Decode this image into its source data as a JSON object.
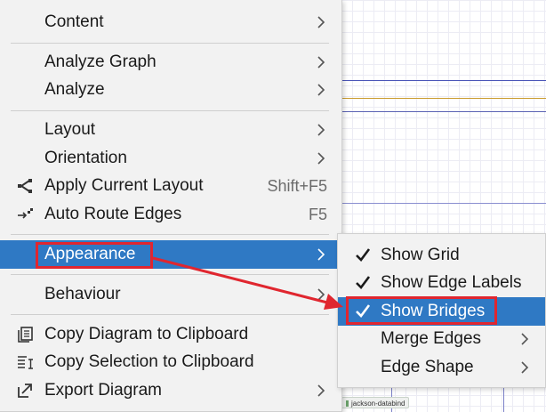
{
  "canvas": {
    "node_label": "jackson-databind"
  },
  "main_menu": {
    "items": [
      {
        "label": "Content",
        "submenu": true
      },
      {
        "label": "Analyze Graph",
        "submenu": true
      },
      {
        "label": "Analyze",
        "submenu": true
      },
      {
        "label": "Layout",
        "submenu": true
      },
      {
        "label": "Orientation",
        "submenu": true
      },
      {
        "label": "Apply Current Layout",
        "shortcut": "Shift+F5",
        "icon": "apply-layout-icon"
      },
      {
        "label": "Auto Route Edges",
        "shortcut": "F5",
        "icon": "auto-route-icon"
      },
      {
        "label": "Appearance",
        "submenu": true,
        "active": true
      },
      {
        "label": "Behaviour",
        "submenu": true
      },
      {
        "label": "Copy Diagram to Clipboard",
        "icon": "copy-diagram-icon"
      },
      {
        "label": "Copy Selection to Clipboard",
        "icon": "copy-selection-icon"
      },
      {
        "label": "Export Diagram",
        "submenu": true,
        "icon": "export-icon"
      }
    ]
  },
  "appearance_submenu": {
    "items": [
      {
        "label": "Show Grid",
        "checked": true
      },
      {
        "label": "Show Edge Labels",
        "checked": true
      },
      {
        "label": "Show Bridges",
        "checked": true,
        "active": true
      },
      {
        "label": "Merge Edges",
        "submenu": true
      },
      {
        "label": "Edge Shape",
        "submenu": true
      }
    ]
  },
  "colors": {
    "menu_bg": "#f2f2f2",
    "selection": "#2f79c4",
    "annotation_red": "#e0262f"
  }
}
